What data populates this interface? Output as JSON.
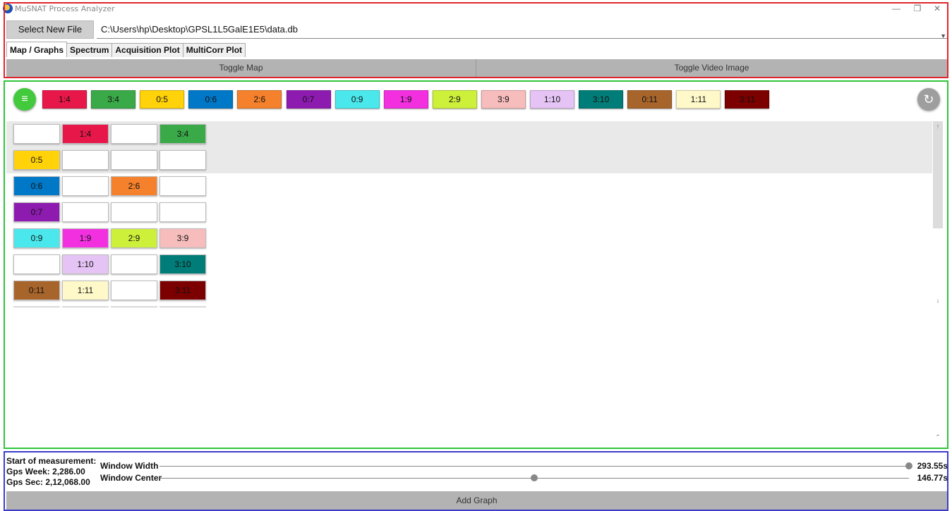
{
  "window": {
    "title": "MuSNAT Process Analyzer",
    "controls": {
      "minimize": "—",
      "restore": "❐",
      "close": "✕"
    }
  },
  "file_bar": {
    "select_button": "Select New File",
    "path": "C:\\Users\\hp\\Desktop\\GPSL1L5GalE1E5\\data.db",
    "dropdown_icon": "chevron-down-icon"
  },
  "tabs": [
    {
      "label": "Map / Graphs",
      "active": true
    },
    {
      "label": "Spectrum",
      "active": false
    },
    {
      "label": "Acquisition Plot",
      "active": false
    },
    {
      "label": "MultiCorr Plot",
      "active": false
    }
  ],
  "toggles": {
    "map": "Toggle Map",
    "video": "Toggle Video Image"
  },
  "toolbar": {
    "menu_icon": "≡",
    "refresh_icon": "↻"
  },
  "chips": [
    {
      "label": "1:4",
      "color": "#e8174a",
      "text": "#111"
    },
    {
      "label": "3:4",
      "color": "#3aaa48",
      "text": "#111"
    },
    {
      "label": "0:5",
      "color": "#ffd20a",
      "text": "#111"
    },
    {
      "label": "0:6",
      "color": "#0078c8",
      "text": "#111"
    },
    {
      "label": "2:6",
      "color": "#f5812c",
      "text": "#111"
    },
    {
      "label": "0:7",
      "color": "#8e1bb0",
      "text": "#111"
    },
    {
      "label": "0:9",
      "color": "#4ae8ec",
      "text": "#111"
    },
    {
      "label": "1:9",
      "color": "#f230e0",
      "text": "#111"
    },
    {
      "label": "2:9",
      "color": "#cdf03a",
      "text": "#111"
    },
    {
      "label": "3:9",
      "color": "#f7bdbd",
      "text": "#111"
    },
    {
      "label": "1:10",
      "color": "#e5c4f5",
      "text": "#111"
    },
    {
      "label": "3:10",
      "color": "#007d78",
      "text": "#111"
    },
    {
      "label": "0:11",
      "color": "#a8652b",
      "text": "#111"
    },
    {
      "label": "1:11",
      "color": "#fff8c8",
      "text": "#111"
    },
    {
      "label": "3:11",
      "color": "#7d0000",
      "text": "#111"
    }
  ],
  "grid_rows": [
    {
      "shaded": true,
      "cells": [
        {
          "label": "",
          "color": "#ffffff"
        },
        {
          "label": "1:4",
          "color": "#e8174a"
        },
        {
          "label": "",
          "color": "#ffffff"
        },
        {
          "label": "3:4",
          "color": "#3aaa48"
        }
      ]
    },
    {
      "shaded": true,
      "cells": [
        {
          "label": "0:5",
          "color": "#ffd20a"
        },
        {
          "label": "",
          "color": "#ffffff"
        },
        {
          "label": "",
          "color": "#ffffff"
        },
        {
          "label": "",
          "color": "#ffffff"
        }
      ]
    },
    {
      "shaded": false,
      "cells": [
        {
          "label": "0:6",
          "color": "#0078c8"
        },
        {
          "label": "",
          "color": "#ffffff"
        },
        {
          "label": "2:6",
          "color": "#f5812c"
        },
        {
          "label": "",
          "color": "#ffffff"
        }
      ]
    },
    {
      "shaded": false,
      "cells": [
        {
          "label": "0:7",
          "color": "#8e1bb0"
        },
        {
          "label": "",
          "color": "#ffffff"
        },
        {
          "label": "",
          "color": "#ffffff"
        },
        {
          "label": "",
          "color": "#ffffff"
        }
      ]
    },
    {
      "shaded": false,
      "cells": [
        {
          "label": "0:9",
          "color": "#4ae8ec"
        },
        {
          "label": "1:9",
          "color": "#f230e0"
        },
        {
          "label": "2:9",
          "color": "#cdf03a"
        },
        {
          "label": "3:9",
          "color": "#f7bdbd"
        }
      ]
    },
    {
      "shaded": false,
      "cells": [
        {
          "label": "",
          "color": "#ffffff"
        },
        {
          "label": "1:10",
          "color": "#e5c4f5"
        },
        {
          "label": "",
          "color": "#ffffff"
        },
        {
          "label": "3:10",
          "color": "#007d78"
        }
      ]
    },
    {
      "shaded": false,
      "cells": [
        {
          "label": "0:11",
          "color": "#a8652b"
        },
        {
          "label": "1:11",
          "color": "#fff8c8"
        },
        {
          "label": "",
          "color": "#ffffff"
        },
        {
          "label": "3:11",
          "color": "#7d0000"
        }
      ]
    },
    {
      "shaded": false,
      "cells": [
        {
          "label": "",
          "color": "#ffffff"
        },
        {
          "label": "",
          "color": "#ffffff"
        },
        {
          "label": "",
          "color": "#ffffff"
        },
        {
          "label": "",
          "color": "#ffffff"
        }
      ]
    }
  ],
  "scrollbar": {
    "up": "↑",
    "down": "↓",
    "bottom": "⌃"
  },
  "measurement": {
    "heading": "Start of measurement:",
    "gps_week": "Gps Week: 2,286.00",
    "gps_sec": "Gps Sec: 2,12,068.00"
  },
  "sliders": {
    "width": {
      "label": "Window Width",
      "value": "293.55s",
      "fraction": 1.0
    },
    "center": {
      "label": "Window Center",
      "value": "146.77s",
      "fraction": 0.5
    }
  },
  "add_graph": "Add Graph"
}
